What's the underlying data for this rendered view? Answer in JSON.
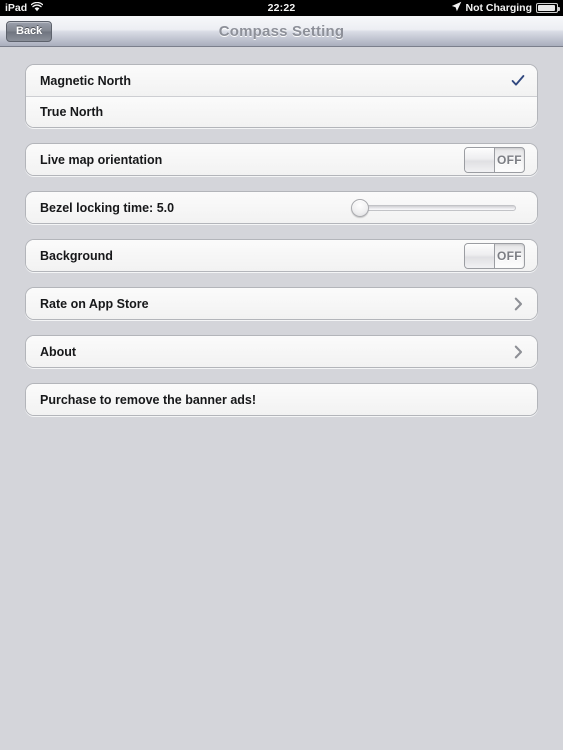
{
  "status_bar": {
    "device": "iPad",
    "wifi_icon": "wifi-icon",
    "time": "22:22",
    "location_icon": "location-arrow-icon",
    "charging_status": "Not Charging",
    "battery_icon": "battery-icon"
  },
  "nav_bar": {
    "back_label": "Back",
    "title": "Compass Setting"
  },
  "groups": [
    {
      "rows": [
        {
          "label": "Magnetic North",
          "accessory": "checkmark",
          "checked": true
        },
        {
          "label": "True North",
          "accessory": "none",
          "checked": false
        }
      ]
    },
    {
      "rows": [
        {
          "label": "Live map orientation",
          "accessory": "switch",
          "switch_value": "OFF"
        }
      ]
    },
    {
      "rows": [
        {
          "label": "Bezel locking time: 5.0",
          "accessory": "slider",
          "slider_value": 0
        }
      ]
    },
    {
      "rows": [
        {
          "label": "Background",
          "accessory": "switch",
          "switch_value": "OFF"
        }
      ]
    },
    {
      "rows": [
        {
          "label": "Rate on App Store",
          "accessory": "chevron"
        }
      ]
    },
    {
      "rows": [
        {
          "label": "About",
          "accessory": "chevron"
        }
      ]
    },
    {
      "rows": [
        {
          "label": "Purchase to remove the banner ads!",
          "accessory": "none"
        }
      ]
    }
  ],
  "colors": {
    "page_background": "#d4d5da",
    "checkmark": "#31487f",
    "chevron": "#8e9096",
    "row_text": "#17181a",
    "nav_title": "#8d9099"
  }
}
